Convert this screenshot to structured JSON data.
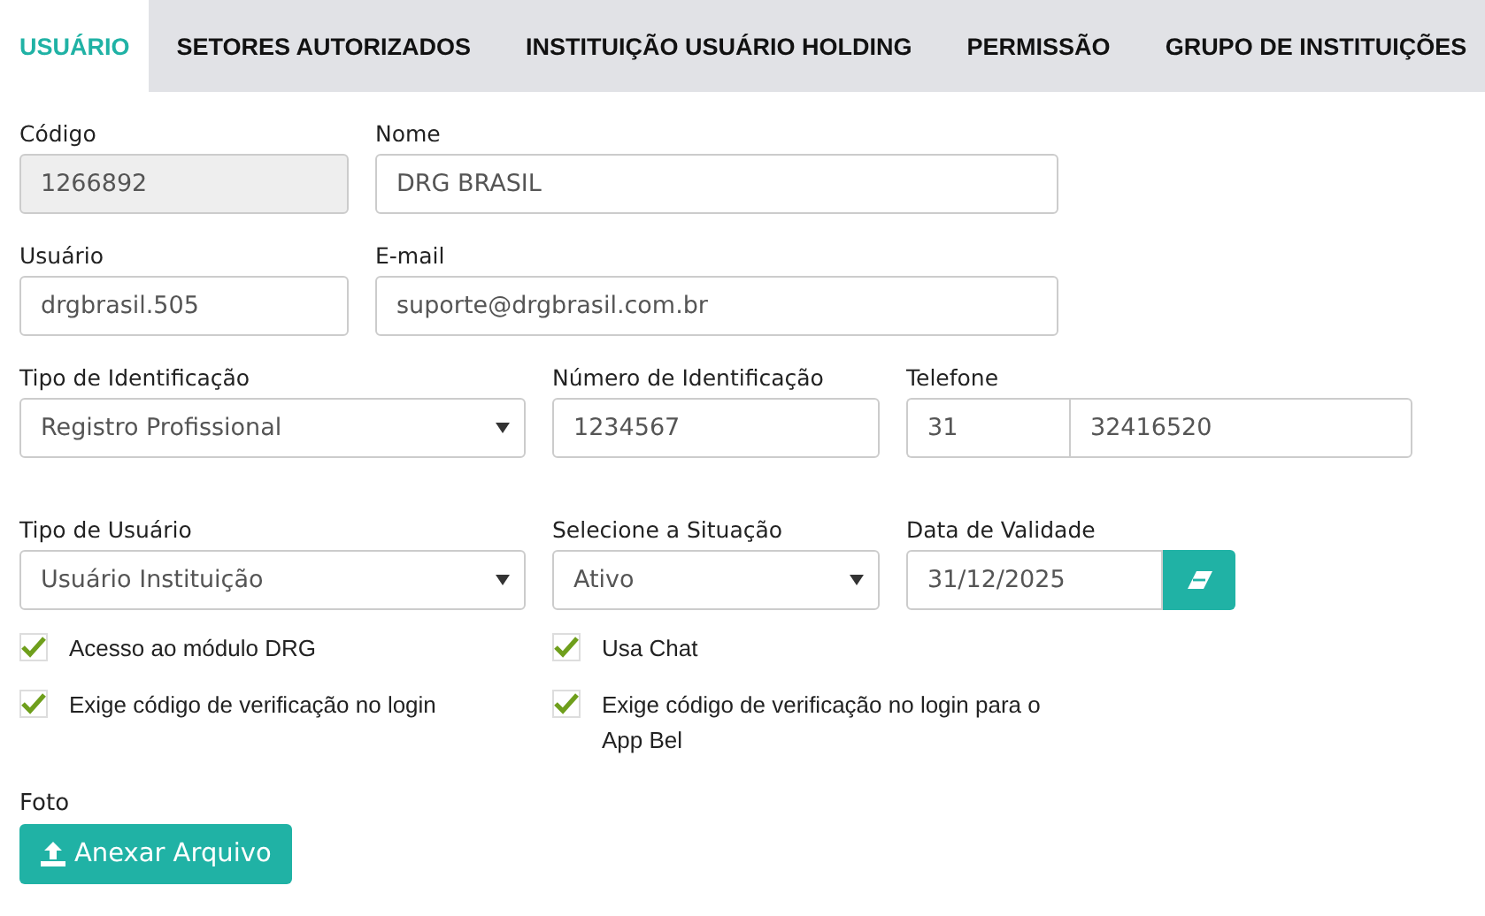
{
  "tabs": [
    {
      "label": "USUÁRIO",
      "selected": true
    },
    {
      "label": "SETORES AUTORIZADOS",
      "selected": false
    },
    {
      "label": "INSTITUIÇÃO USUÁRIO HOLDING",
      "selected": false
    },
    {
      "label": "PERMISSÃO",
      "selected": false
    },
    {
      "label": "GRUPO DE INSTITUIÇÕES",
      "selected": false
    }
  ],
  "rows": [
    {
      "fields": [
        {
          "kind": "text",
          "label": "Código",
          "value": "1266892",
          "disabled": true
        },
        {
          "kind": "text",
          "label": "Nome",
          "value": "DRG BRASIL",
          "disabled": false
        }
      ]
    },
    {
      "fields": [
        {
          "kind": "text",
          "label": "Usuário",
          "value": "drgbrasil.505",
          "disabled": false
        },
        {
          "kind": "text",
          "label": "E-mail",
          "value": "suporte@drgbrasil.com.br",
          "disabled": false
        }
      ]
    },
    {
      "fields": [
        {
          "kind": "select",
          "label": "Tipo de Identificação",
          "value": "Registro Profissional"
        },
        {
          "kind": "text",
          "label": "Número de Identificação",
          "value": "1234567",
          "disabled": false
        },
        {
          "kind": "phone",
          "label": "Telefone",
          "area": "31",
          "value": "32416520"
        }
      ]
    },
    {
      "fields": [
        {
          "kind": "select",
          "label": "Tipo de Usuário",
          "value": "Usuário Instituição"
        },
        {
          "kind": "select",
          "label": "Selecione a Situação",
          "value": "Ativo"
        },
        {
          "kind": "date",
          "label": "Data de Validade",
          "value": "31/12/2025"
        }
      ]
    }
  ],
  "checkboxes": [
    {
      "label": "Acesso ao módulo DRG",
      "checked": true
    },
    {
      "label": "Usa Chat",
      "checked": true
    },
    {
      "label": "Exige código de verificação no login",
      "checked": true
    },
    {
      "label": "Exige código de verificação no login para o App Bel",
      "checked": true
    }
  ],
  "photo": {
    "label": "Foto",
    "button": "Anexar Arquivo"
  }
}
